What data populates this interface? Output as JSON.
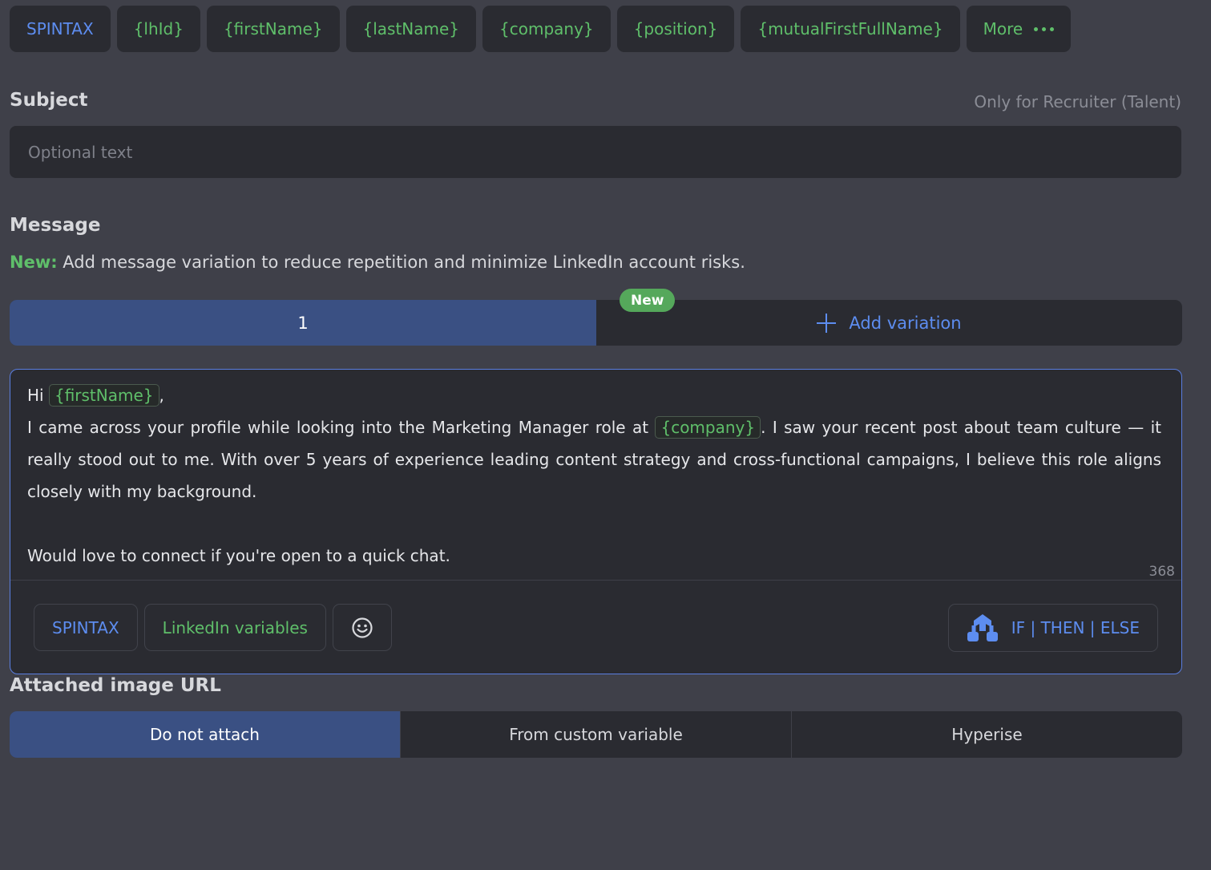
{
  "toolbar": {
    "items": [
      {
        "label": "SPINTAX"
      },
      {
        "label": "{lhId}"
      },
      {
        "label": "{firstName}"
      },
      {
        "label": "{lastName}"
      },
      {
        "label": "{company}"
      },
      {
        "label": "{position}"
      },
      {
        "label": "{mutualFirstFullName}"
      }
    ],
    "more_label": "More",
    "more_icon": "more-dots-icon"
  },
  "subject": {
    "label": "Subject",
    "note": "Only for Recruiter (Talent)",
    "placeholder": "Optional text",
    "value": ""
  },
  "message": {
    "label": "Message",
    "new_prefix": "New:",
    "new_text": " Add message variation to reduce repetition and minimize LinkedIn account risks.",
    "variation_tab": "1",
    "new_badge": "New",
    "add_variation": "Add variation",
    "editor": {
      "greeting": "Hi",
      "greeting_var": "{firstName}",
      "greeting_end": ",",
      "line1_before": "I came across your profile while looking into the Marketing Manager role at",
      "line1_var": "{company}",
      "line1_after": ". I saw your recent post about team culture — it really stood out to me. With over 5 years of experience leading content strategy and cross-functional campaigns, I believe this role aligns closely with my background.",
      "closing": "Would love to connect if you're open to a quick chat.",
      "char_count": "368"
    },
    "tools": {
      "spintax": "SPINTAX",
      "linkedin_vars": "LinkedIn variables",
      "emoji_icon": "smiley-icon",
      "ifelse": "IF | THEN | ELSE",
      "ifelse_icon": "branch-icon"
    }
  },
  "attachment": {
    "label": "Attached image URL",
    "options": [
      "Do not attach",
      "From custom variable",
      "Hyperise"
    ],
    "selected": "Do not attach"
  },
  "colors": {
    "background": "#3f4049",
    "panel": "#2a2b31",
    "accent_blue": "#5d8df0",
    "accent_green": "#5fbf6a",
    "selected": "#3a5083"
  }
}
